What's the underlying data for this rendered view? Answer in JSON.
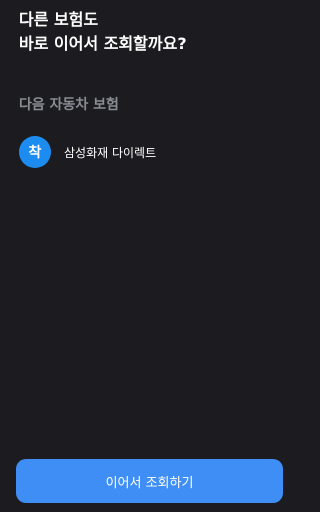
{
  "headline": {
    "line1": "다른 보험도",
    "line2": "바로 이어서 조회할까요?"
  },
  "section": {
    "label": "다음 자동차 보험"
  },
  "insurers": [
    {
      "icon_glyph": "착",
      "icon_name": "samsung-direct-logo-icon",
      "name": "삼성화재 다이렉트",
      "brand_color": "#1c8cf0"
    }
  ],
  "cta": {
    "label": "이어서 조회하기",
    "color": "#3f8ef5"
  },
  "theme": {
    "background": "#1c1c20",
    "muted_text": "#8a8c94"
  }
}
